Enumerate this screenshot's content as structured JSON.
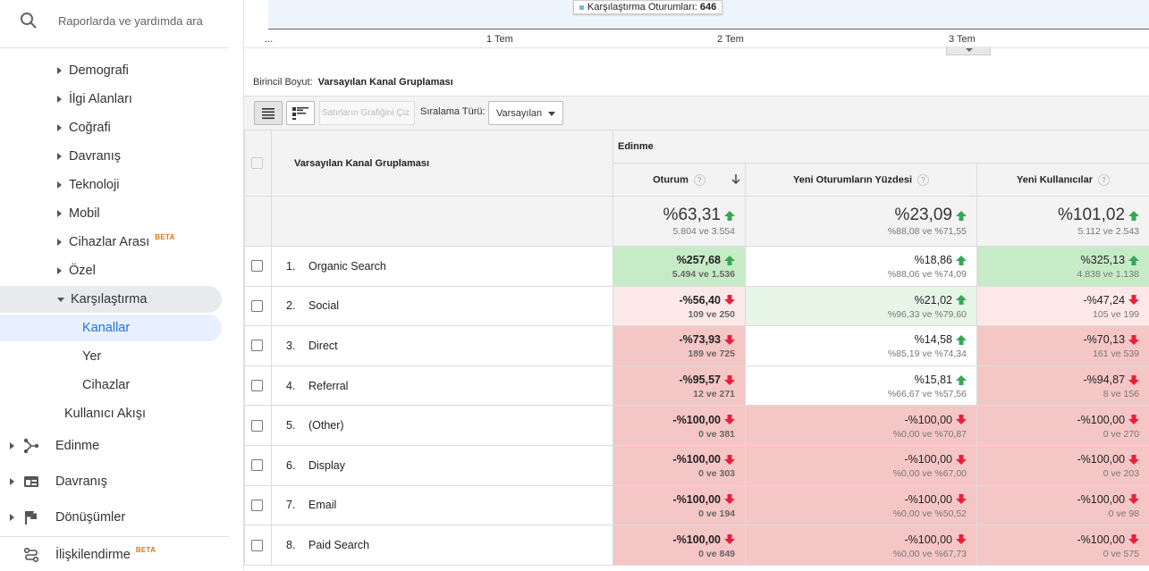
{
  "search": {
    "placeholder": "Raporlarda ve yardımda ara"
  },
  "sidebar": {
    "items": [
      {
        "label": "Demografi"
      },
      {
        "label": "İlgi Alanları"
      },
      {
        "label": "Coğrafi"
      },
      {
        "label": "Davranış"
      },
      {
        "label": "Teknoloji"
      },
      {
        "label": "Mobil"
      },
      {
        "label": "Cihazlar Arası",
        "badge": "BETA"
      },
      {
        "label": "Özel"
      },
      {
        "label": "Karşılaştırma"
      }
    ],
    "sub_items": [
      {
        "label": "Kanallar"
      },
      {
        "label": "Yer"
      },
      {
        "label": "Cihazlar"
      }
    ],
    "user_flow": "Kullanıcı Akışı",
    "sections": [
      {
        "label": "Edinme",
        "icon": "acquisition-icon"
      },
      {
        "label": "Davranış",
        "icon": "behavior-icon"
      },
      {
        "label": "Dönüşümler",
        "icon": "flag-icon"
      },
      {
        "label": "İlişkilendirme",
        "icon": "attribution-icon",
        "badge": "BETA"
      }
    ]
  },
  "chart": {
    "tooltip": "Karşılaştırma Oturumları:",
    "tooltip_value": "646",
    "x_labels": [
      "...",
      "1 Tem",
      "2 Tem",
      "3 Tem"
    ]
  },
  "dimension": {
    "label": "Birincil Boyut:",
    "value": "Varsayılan Kanal Gruplaması"
  },
  "toolbar": {
    "plot_rows": "Satırların Grafiğini Çiz",
    "sort_label": "Sıralama Türü:",
    "sort_value": "Varsayılan"
  },
  "table": {
    "dim_header": "Varsayılan Kanal Gruplaması",
    "group_header": "Edinme",
    "columns": [
      "Oturum",
      "Yeni Oturumların Yüzdesi",
      "Yeni Kullanıcılar"
    ],
    "help": "?",
    "totals": [
      {
        "value": "%63,31",
        "sub": "5.804 ve 3.554",
        "dir": "up"
      },
      {
        "value": "%23,09",
        "sub": "%88,08 ve %71,55",
        "dir": "up"
      },
      {
        "value": "%101,02",
        "sub": "5.112 ve 2.543",
        "dir": "up"
      }
    ],
    "rows": [
      {
        "idx": "1.",
        "name": "Organic Search",
        "cells": [
          {
            "value": "%257,68",
            "sub": "5.494 ve 1.536",
            "dir": "up",
            "bg": "g1"
          },
          {
            "value": "%18,86",
            "sub": "%88,06 ve %74,09",
            "dir": "up",
            "bg": "w"
          },
          {
            "value": "%325,13",
            "sub": "4.838 ve 1.138",
            "dir": "up",
            "bg": "g1"
          }
        ]
      },
      {
        "idx": "2.",
        "name": "Social",
        "cells": [
          {
            "value": "-%56,40",
            "sub": "109 ve 250",
            "dir": "down",
            "bg": "r1"
          },
          {
            "value": "%21,02",
            "sub": "%96,33 ve %79,60",
            "dir": "up",
            "bg": "g2"
          },
          {
            "value": "-%47,24",
            "sub": "105 ve 199",
            "dir": "down",
            "bg": "r1"
          }
        ]
      },
      {
        "idx": "3.",
        "name": "Direct",
        "cells": [
          {
            "value": "-%73,93",
            "sub": "189 ve 725",
            "dir": "down",
            "bg": "r2"
          },
          {
            "value": "%14,58",
            "sub": "%85,19 ve %74,34",
            "dir": "up",
            "bg": "w"
          },
          {
            "value": "-%70,13",
            "sub": "161 ve 539",
            "dir": "down",
            "bg": "r2"
          }
        ]
      },
      {
        "idx": "4.",
        "name": "Referral",
        "cells": [
          {
            "value": "-%95,57",
            "sub": "12 ve 271",
            "dir": "down",
            "bg": "r2"
          },
          {
            "value": "%15,81",
            "sub": "%66,67 ve %57,56",
            "dir": "up",
            "bg": "w"
          },
          {
            "value": "-%94,87",
            "sub": "8 ve 156",
            "dir": "down",
            "bg": "r2"
          }
        ]
      },
      {
        "idx": "5.",
        "name": "(Other)",
        "cells": [
          {
            "value": "-%100,00",
            "sub": "0 ve 381",
            "dir": "down",
            "bg": "r2"
          },
          {
            "value": "-%100,00",
            "sub": "%0,00 ve %70,87",
            "dir": "down",
            "bg": "r2"
          },
          {
            "value": "-%100,00",
            "sub": "0 ve 270",
            "dir": "down",
            "bg": "r2"
          }
        ]
      },
      {
        "idx": "6.",
        "name": "Display",
        "cells": [
          {
            "value": "-%100,00",
            "sub": "0 ve 303",
            "dir": "down",
            "bg": "r2"
          },
          {
            "value": "-%100,00",
            "sub": "%0,00 ve %67,00",
            "dir": "down",
            "bg": "r2"
          },
          {
            "value": "-%100,00",
            "sub": "0 ve 203",
            "dir": "down",
            "bg": "r2"
          }
        ]
      },
      {
        "idx": "7.",
        "name": "Email",
        "cells": [
          {
            "value": "-%100,00",
            "sub": "0 ve 194",
            "dir": "down",
            "bg": "r2"
          },
          {
            "value": "-%100,00",
            "sub": "%0,00 ve %50,52",
            "dir": "down",
            "bg": "r2"
          },
          {
            "value": "-%100,00",
            "sub": "0 ve 98",
            "dir": "down",
            "bg": "r2"
          }
        ]
      },
      {
        "idx": "8.",
        "name": "Paid Search",
        "cells": [
          {
            "value": "-%100,00",
            "sub": "0 ve 849",
            "dir": "down",
            "bg": "r2"
          },
          {
            "value": "-%100,00",
            "sub": "%0,00 ve %67,73",
            "dir": "down",
            "bg": "r2"
          },
          {
            "value": "-%100,00",
            "sub": "0 ve 575",
            "dir": "down",
            "bg": "r2"
          }
        ]
      }
    ]
  },
  "colors": {
    "up": "#34a853",
    "down": "#ea1e3b",
    "accent": "#1a73e8"
  }
}
